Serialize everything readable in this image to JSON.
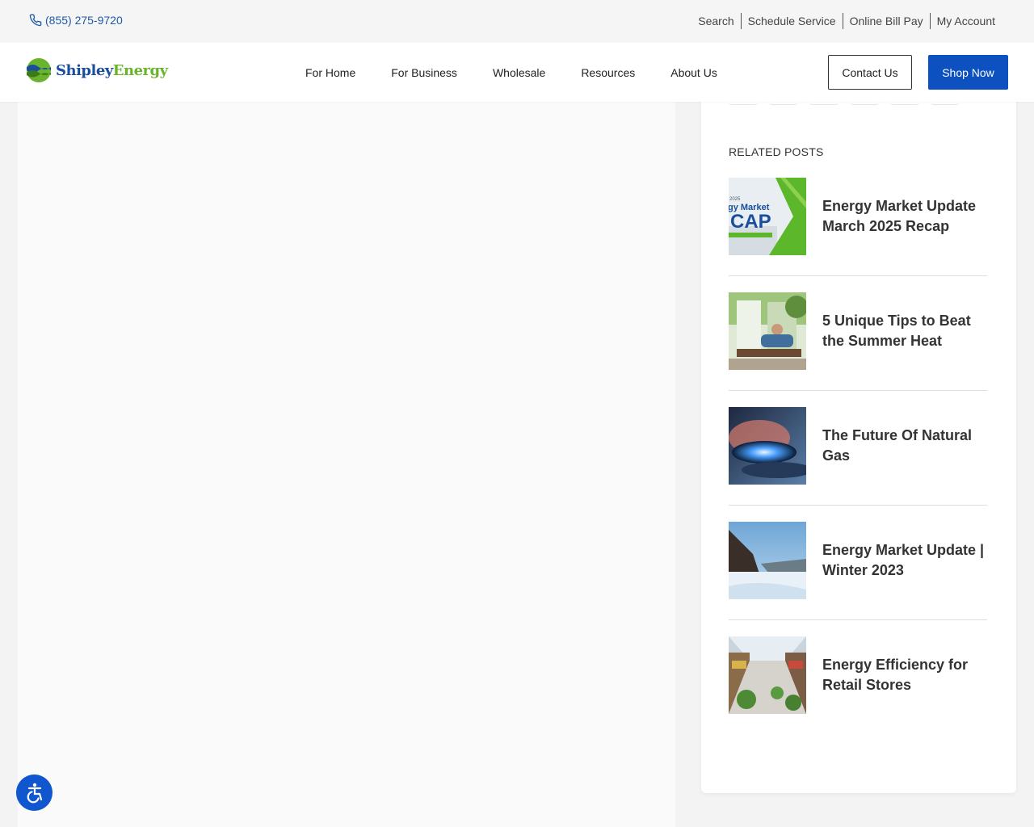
{
  "topbar": {
    "phone": "(855) 275-9720",
    "links": [
      "Search",
      "Schedule Service",
      "Online Bill Pay",
      "My Account"
    ]
  },
  "header": {
    "logo_part1": "Shipley",
    "logo_part2": "Energy",
    "nav": [
      "For Home",
      "For Business",
      "Wholesale",
      "Resources",
      "About Us"
    ],
    "contact_label": "Contact Us",
    "shop_label": "Shop Now"
  },
  "sidebar": {
    "related_title": "RELATED POSTS",
    "posts": [
      {
        "title": "Energy Market Update March 2025 Recap"
      },
      {
        "title": "5 Unique Tips to Beat the Summer Heat"
      },
      {
        "title": "The Future Of Natural Gas"
      },
      {
        "title": "Energy Market Update | Winter 2023"
      },
      {
        "title": "Energy Efficiency for Retail Stores"
      }
    ],
    "thumb1_text": {
      "year": "2025",
      "line1": "gy Market",
      "line2": "CAP"
    }
  },
  "colors": {
    "brand_blue": "#1a4e9c",
    "brand_green": "#6ab42d",
    "shop_button": "#0d50c0",
    "phone_link": "#1f5aa8"
  },
  "icons": {
    "phone": "phone-icon",
    "accessibility": "accessibility-icon"
  }
}
